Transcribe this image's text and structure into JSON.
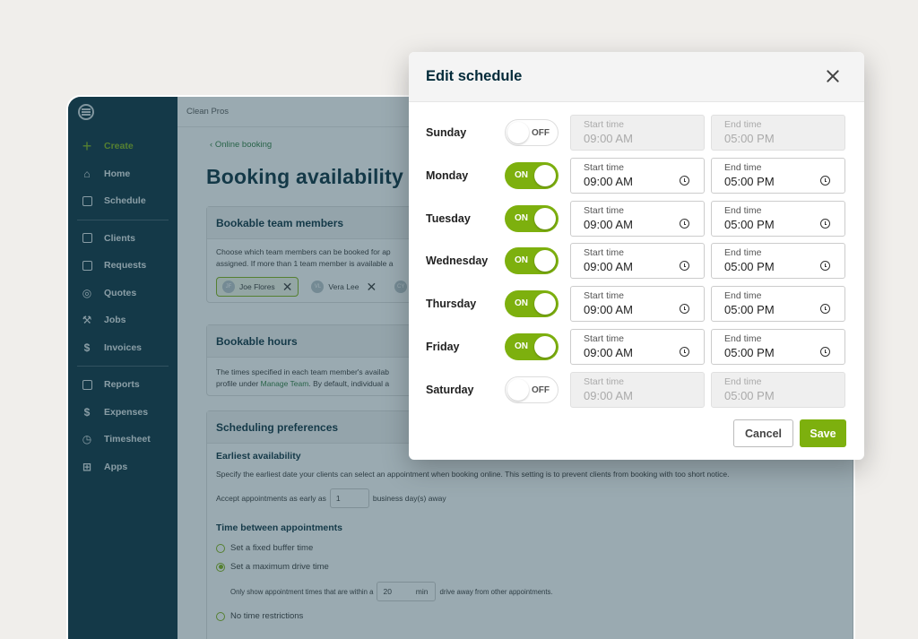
{
  "app": {
    "org_name": "Clean Pros",
    "sidebar": {
      "items": [
        {
          "label": "Create",
          "icon": "plus-icon"
        },
        {
          "label": "Home",
          "icon": "home-icon"
        },
        {
          "label": "Schedule",
          "icon": "calendar-icon"
        },
        {
          "label": "Clients",
          "icon": "clients-icon"
        },
        {
          "label": "Requests",
          "icon": "requests-icon"
        },
        {
          "label": "Quotes",
          "icon": "quotes-icon"
        },
        {
          "label": "Jobs",
          "icon": "hammer-icon"
        },
        {
          "label": "Invoices",
          "icon": "invoice-icon"
        },
        {
          "label": "Reports",
          "icon": "reports-icon"
        },
        {
          "label": "Expenses",
          "icon": "expenses-icon"
        },
        {
          "label": "Timesheet",
          "icon": "clock-icon"
        },
        {
          "label": "Apps",
          "icon": "apps-icon"
        }
      ]
    },
    "breadcrumb": "Online booking",
    "page_title": "Booking availability",
    "team_card": {
      "title": "Bookable team members",
      "text_line1": "Choose which team members can be booked for ap",
      "text_line2": "assigned. If more than 1 team member is available a",
      "chips": [
        {
          "initials": "JF",
          "name": "Joe Flores"
        },
        {
          "initials": "VL",
          "name": "Vera Lee"
        },
        {
          "initials": "CY",
          "name": ""
        }
      ]
    },
    "hours_card": {
      "title": "Bookable hours",
      "text_line1": "The times specified in each team member's availab",
      "text_line2_prefix": "profile under ",
      "text_line2_link": "Manage Team",
      "text_line2_suffix": ". By default, individual a"
    },
    "prefs_card": {
      "title": "Scheduling preferences",
      "earliest_title": "Earliest availability",
      "earliest_text": "Specify the earliest date your clients can select an appointment when booking online. This setting is to prevent clients from booking with too short notice.",
      "accept_prefix": "Accept appointments as early as",
      "accept_value": "1",
      "accept_suffix": "business day(s) away",
      "between_title": "Time between appointments",
      "options": [
        {
          "label": "Set a fixed buffer time",
          "selected": false
        },
        {
          "label": "Set a maximum drive time",
          "selected": true
        },
        {
          "label": "No time restrictions",
          "selected": false
        }
      ],
      "drive_prefix": "Only show appointment times that are within a",
      "drive_value": "20",
      "drive_unit": "min",
      "drive_suffix": "drive away from other appointments."
    }
  },
  "modal": {
    "title": "Edit schedule",
    "start_label": "Start time",
    "end_label": "End time",
    "days": [
      {
        "name": "Sunday",
        "enabled": false,
        "toggle": "OFF",
        "start": "09:00 AM",
        "end": "05:00 PM"
      },
      {
        "name": "Monday",
        "enabled": true,
        "toggle": "ON",
        "start": "09:00 AM",
        "end": "05:00 PM"
      },
      {
        "name": "Tuesday",
        "enabled": true,
        "toggle": "ON",
        "start": "09:00 AM",
        "end": "05:00 PM"
      },
      {
        "name": "Wednesday",
        "enabled": true,
        "toggle": "ON",
        "start": "09:00 AM",
        "end": "05:00 PM"
      },
      {
        "name": "Thursday",
        "enabled": true,
        "toggle": "ON",
        "start": "09:00 AM",
        "end": "05:00 PM"
      },
      {
        "name": "Friday",
        "enabled": true,
        "toggle": "ON",
        "start": "09:00 AM",
        "end": "05:00 PM"
      },
      {
        "name": "Saturday",
        "enabled": false,
        "toggle": "OFF",
        "start": "09:00 AM",
        "end": "05:00 PM"
      }
    ],
    "cancel_label": "Cancel",
    "save_label": "Save"
  },
  "colors": {
    "brand_green": "#7db00e",
    "sidebar_bg": "#032b3a"
  }
}
